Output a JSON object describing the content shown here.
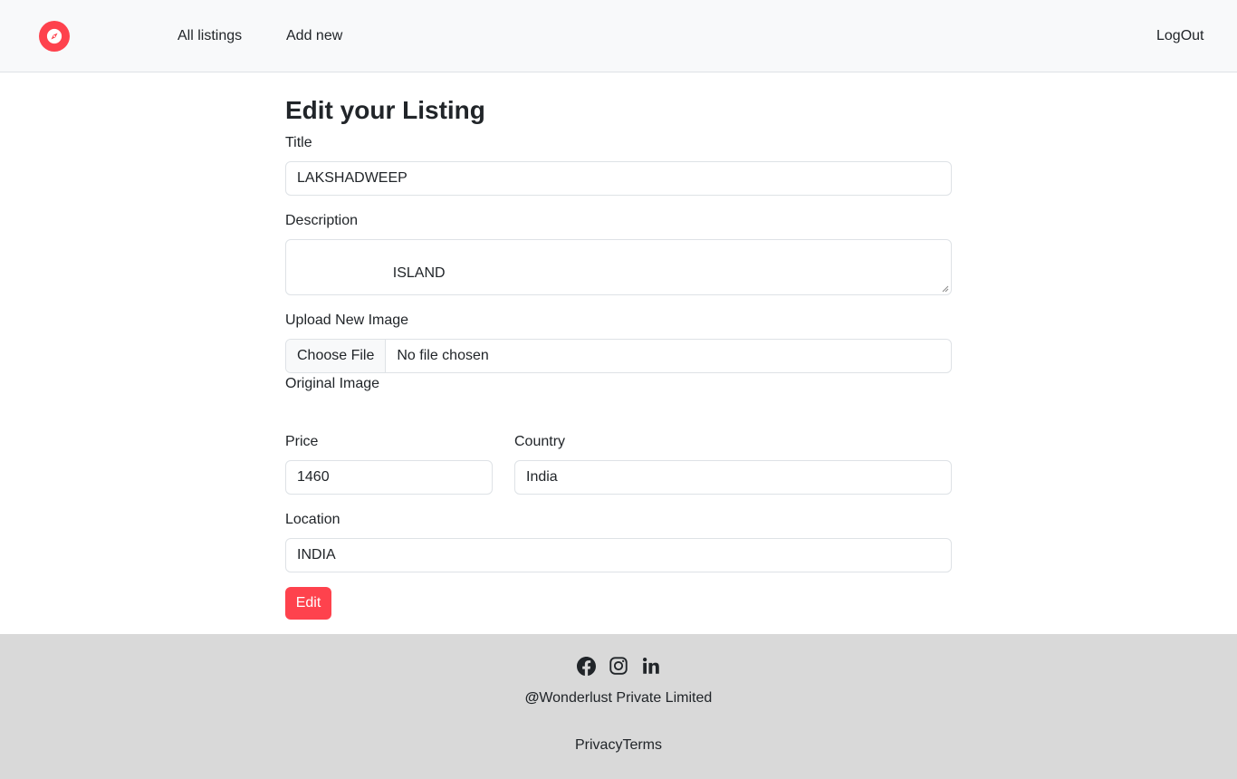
{
  "nav": {
    "logo_icon": "compass-icon",
    "brand_color": "#fe424d",
    "all_listings": "All listings",
    "add_new": "Add new",
    "logout": "LogOut"
  },
  "form": {
    "heading": "Edit your Listing",
    "title_label": "Title",
    "title_value": "LAKSHADWEEP",
    "description_label": "Description",
    "description_value": "ISLAND",
    "upload_label": "Upload New Image",
    "choose_file": "Choose File",
    "no_file": "No file chosen",
    "original_image_label": "Original Image",
    "price_label": "Price",
    "price_value": "1460",
    "country_label": "Country",
    "country_value": "India",
    "location_label": "Location",
    "location_value": "INDIA",
    "submit": "Edit"
  },
  "footer": {
    "social_icons": [
      "facebook-icon",
      "instagram-icon",
      "linkedin-icon"
    ],
    "brand": "Wonderlust Private Limited",
    "brand_prefix": "@",
    "privacy": "Privacy",
    "terms": "Terms"
  }
}
